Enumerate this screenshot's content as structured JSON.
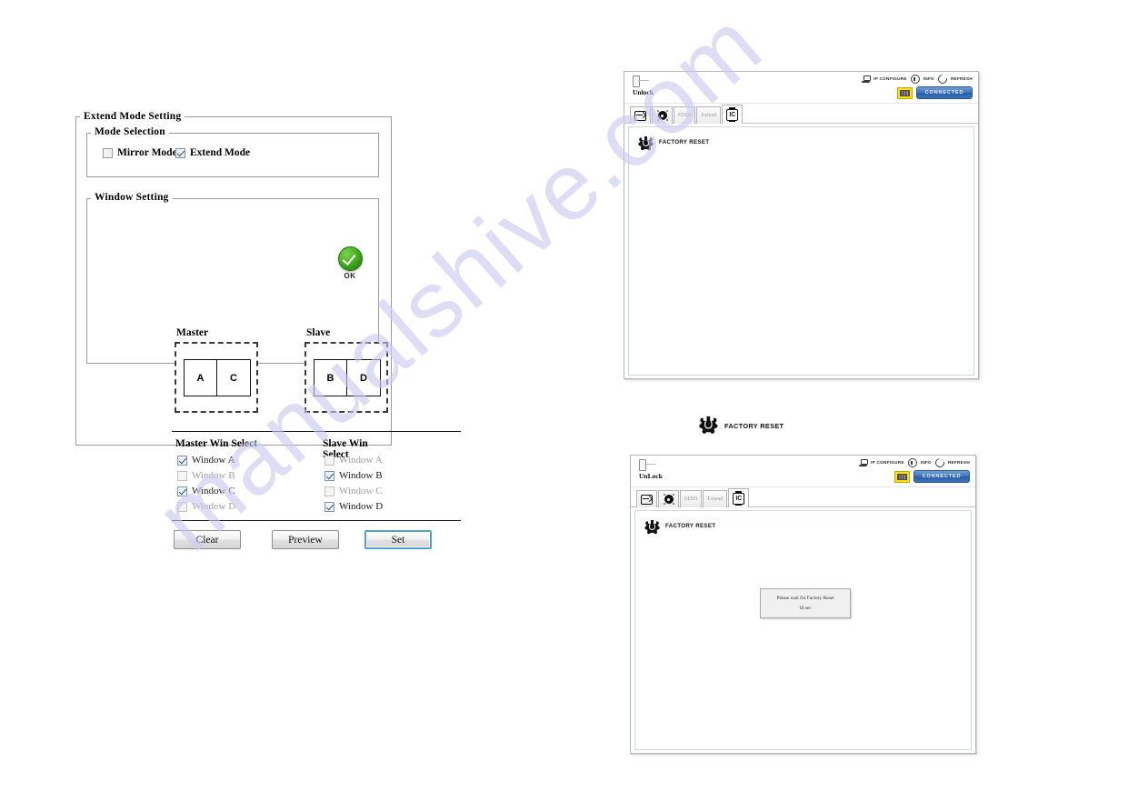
{
  "watermark": {
    "text": "manualshive.com"
  },
  "extend_panel": {
    "title": "Extend Mode Setting",
    "mode_selection": {
      "legend": "Mode Selection",
      "options": [
        {
          "label": "Mirror Mode",
          "checked": false
        },
        {
          "label": "Extend Mode",
          "checked": true
        }
      ],
      "status_badge": {
        "icon": "check-circle-icon",
        "label": "OK",
        "color": "#3faa1e"
      }
    },
    "window_setting": {
      "legend": "Window Setting",
      "master": {
        "title": "Master",
        "cells": [
          "A",
          "C"
        ]
      },
      "slave": {
        "title": "Slave",
        "cells": [
          "B",
          "D"
        ]
      },
      "master_select": {
        "title": "Master Win Select",
        "items": [
          {
            "label": "Window A",
            "checked": true,
            "enabled": true
          },
          {
            "label": "Window B",
            "checked": false,
            "enabled": false
          },
          {
            "label": "Window C",
            "checked": true,
            "enabled": true
          },
          {
            "label": "Window D",
            "checked": false,
            "enabled": false
          }
        ]
      },
      "slave_select": {
        "title": "Slave Win Select",
        "items": [
          {
            "label": "Window A",
            "checked": false,
            "enabled": false
          },
          {
            "label": "Window B",
            "checked": true,
            "enabled": true
          },
          {
            "label": "Window C",
            "checked": false,
            "enabled": false
          },
          {
            "label": "Window D",
            "checked": true,
            "enabled": true
          }
        ]
      },
      "buttons": [
        {
          "label": "Clear",
          "focused": false
        },
        {
          "label": "Preview",
          "focused": false
        },
        {
          "label": "Set",
          "focused": true
        }
      ]
    }
  },
  "app_window_top": {
    "lock": {
      "icon": "padlock-icon",
      "label": "Unlock"
    },
    "header_actions": [
      {
        "icon": "ip-configure-icon",
        "label": "IP CONFIGURE"
      },
      {
        "icon": "info-icon",
        "label": "INFO"
      },
      {
        "icon": "refresh-icon",
        "label": "REFRESH"
      }
    ],
    "keypad_badge": {
      "icon": "keypad-icon",
      "color": "#ffe300"
    },
    "connect_button": {
      "label": "CONNECTED",
      "color": "#3f74bb"
    },
    "tabs": [
      {
        "label": "",
        "icon": "input-select-icon",
        "active": false,
        "enabled": true
      },
      {
        "label": "",
        "icon": "gear-icon",
        "active": false,
        "enabled": true
      },
      {
        "label": "EDID",
        "icon": "",
        "active": false,
        "enabled": false
      },
      {
        "label": "Extend",
        "icon": "",
        "active": false,
        "enabled": false
      },
      {
        "label": "",
        "icon": "ic-chip-icon",
        "active": true,
        "enabled": true
      }
    ],
    "content": {
      "factory_reset_label": "FACTORY RESET",
      "factory_reset_icon": "factory-reset-icon"
    }
  },
  "factory_reset_caption": {
    "icon": "factory-reset-icon",
    "label": "FACTORY RESET"
  },
  "app_window_bottom": {
    "lock": {
      "icon": "padlock-icon",
      "label": "UnLock"
    },
    "header_actions": [
      {
        "icon": "ip-configure-icon",
        "label": "IP CONFIGURE"
      },
      {
        "icon": "info-icon",
        "label": "INFO"
      },
      {
        "icon": "refresh-icon",
        "label": "REFRESH"
      }
    ],
    "keypad_badge": {
      "icon": "keypad-icon",
      "color": "#ffe300"
    },
    "connect_button": {
      "label": "CONNECTED",
      "color": "#3f74bb"
    },
    "tabs": [
      {
        "label": "",
        "icon": "input-select-icon",
        "active": false,
        "enabled": true
      },
      {
        "label": "",
        "icon": "gear-icon",
        "active": false,
        "enabled": true
      },
      {
        "label": "EDID",
        "icon": "",
        "active": false,
        "enabled": false
      },
      {
        "label": "Extend",
        "icon": "",
        "active": false,
        "enabled": false
      },
      {
        "label": "",
        "icon": "ic-chip-icon",
        "active": true,
        "enabled": true
      }
    ],
    "content": {
      "factory_reset_label": "FACTORY RESET",
      "factory_reset_icon": "factory-reset-icon"
    },
    "wait_dialog": {
      "message": "Please wait for Factory Reset",
      "countdown": "18 sec"
    }
  }
}
